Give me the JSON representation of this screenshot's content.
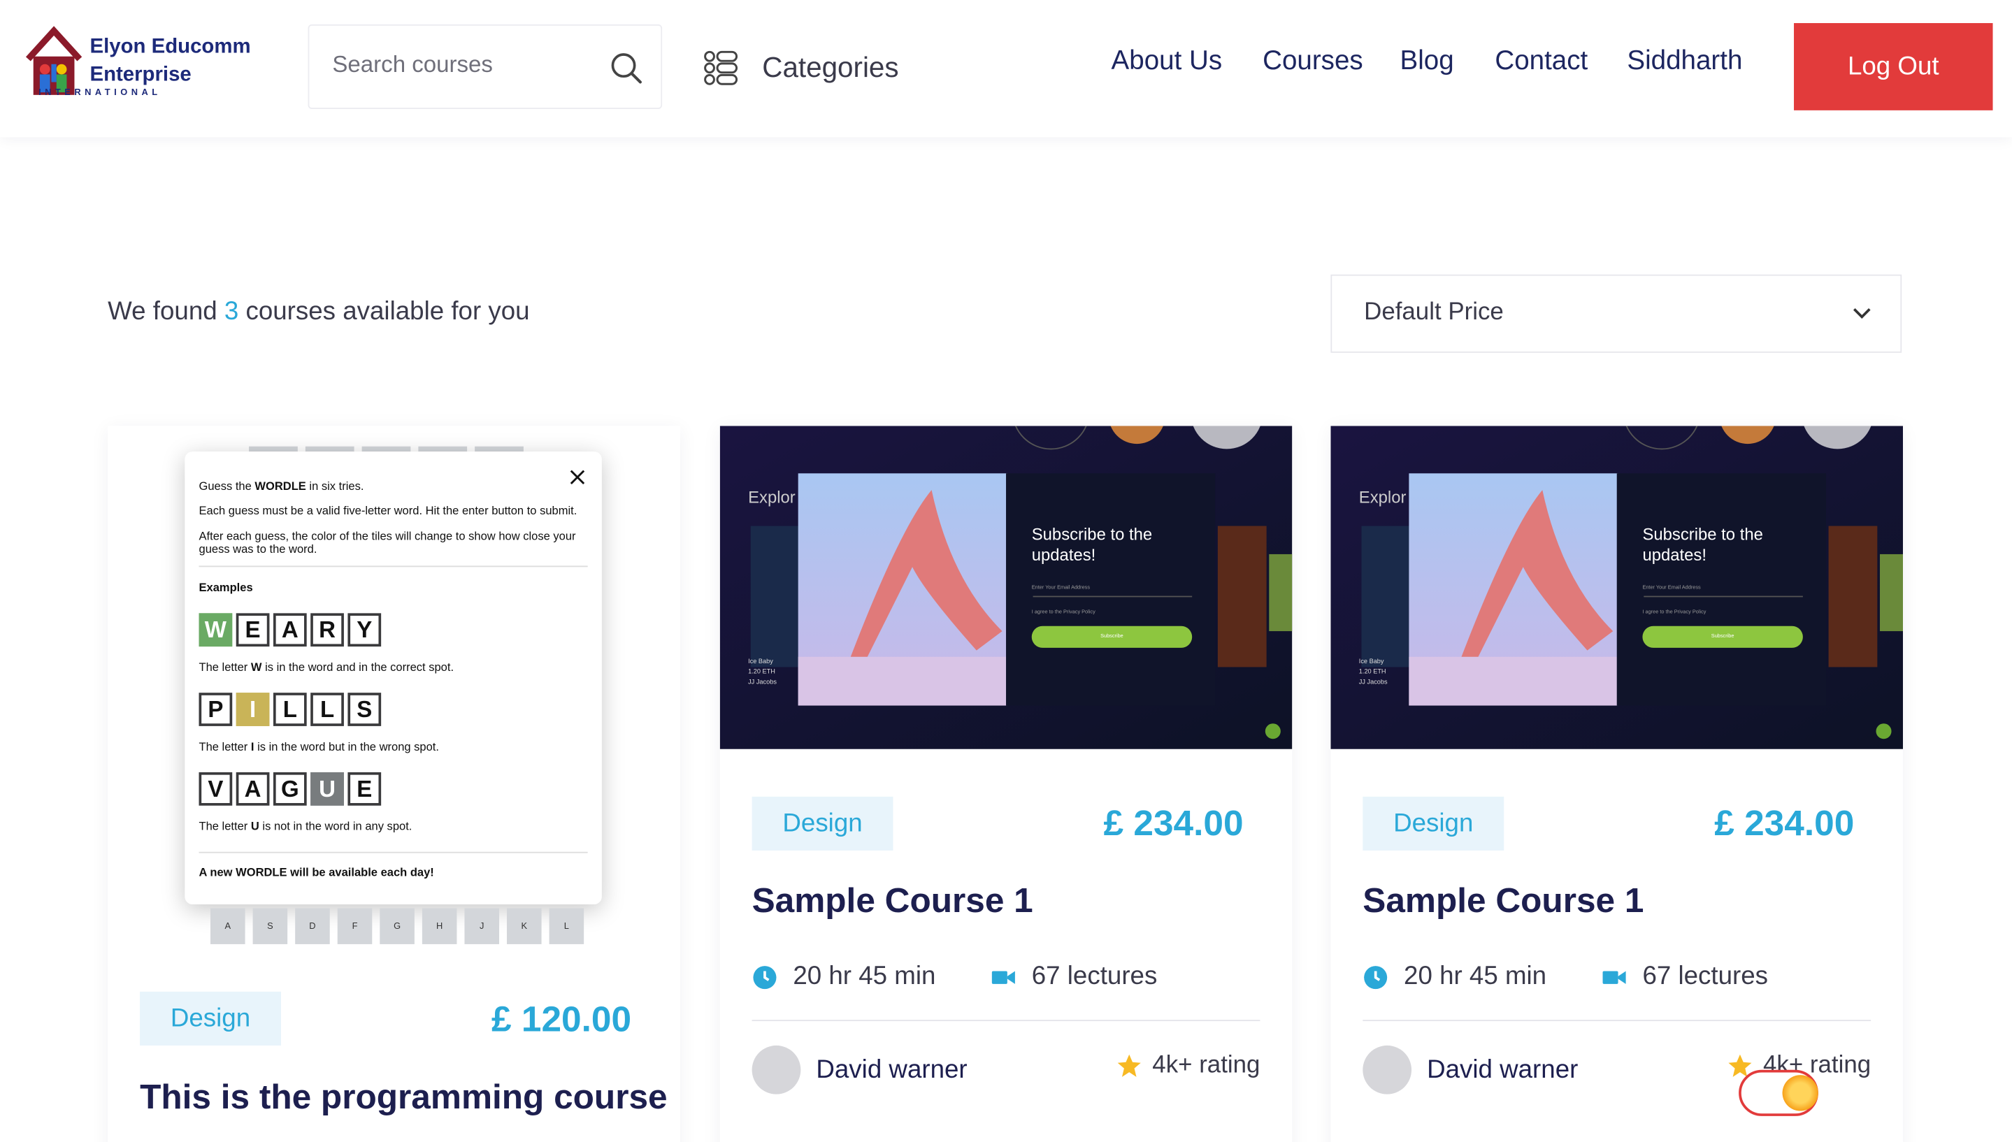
{
  "brand": {
    "line1": "Elyon Educomm",
    "line2": "Enterprise",
    "line3": "INTERNATIONAL"
  },
  "search": {
    "placeholder": "Search courses"
  },
  "categories_label": "Categories",
  "nav": [
    "About Us",
    "Courses",
    "Blog",
    "Contact",
    "Siddharth"
  ],
  "logout_label": "Log Out",
  "found": {
    "prefix": "We found",
    "count": "3",
    "suffix": "courses available for you"
  },
  "sort": {
    "selected": "Default Price"
  },
  "colors": {
    "accent": "#2aa8d8",
    "danger": "#e23b3b",
    "heading": "#1d1f4f"
  },
  "cards": [
    {
      "category": "Design",
      "price": "£ 120.00",
      "title": "This is the programming course",
      "thumb": {
        "type": "wordle",
        "intro_pre": "Guess the ",
        "intro_bold": "WORDLE",
        "intro_post": " in six tries.",
        "rule1": "Each guess must be a valid five-letter word. Hit the enter button to submit.",
        "rule2": "After each guess, the color of the tiles will change to show how close your guess was to the word.",
        "examples_label": "Examples",
        "ex1_letters": [
          "W",
          "E",
          "A",
          "R",
          "Y"
        ],
        "ex1_pre": "The letter ",
        "ex1_bold": "W",
        "ex1_post": " is in the word and in the correct spot.",
        "ex2_letters": [
          "P",
          "I",
          "L",
          "L",
          "S"
        ],
        "ex2_pre": "The letter ",
        "ex2_bold": "I",
        "ex2_post": " is in the word but in the wrong spot.",
        "ex3_letters": [
          "V",
          "A",
          "G",
          "U",
          "E"
        ],
        "ex3_pre": "The letter ",
        "ex3_bold": "U",
        "ex3_post": " is not in the word in any spot.",
        "footer": "A new WORDLE will be available each day!",
        "keys": [
          "A",
          "S",
          "D",
          "F",
          "G",
          "H",
          "J",
          "K",
          "L"
        ]
      }
    },
    {
      "category": "Design",
      "price": "£ 234.00",
      "title": "Sample Course 1",
      "duration": "20 hr 45 min",
      "lectures": "67 lectures",
      "author": "David warner",
      "rating": "4k+ rating",
      "thumb": {
        "type": "subscribe",
        "heading": "Subscribe to the updates!",
        "explore": "Explor",
        "email_placeholder": "Enter Your Email Address",
        "agree": "I agree to the Privacy Policy",
        "button": "Subscribe",
        "item_name": "Ice Baby",
        "item_price": "1.20 ETH",
        "item_author": "JJ Jacobs"
      }
    },
    {
      "category": "Design",
      "price": "£ 234.00",
      "title": "Sample Course 1",
      "duration": "20 hr 45 min",
      "lectures": "67 lectures",
      "author": "David warner",
      "rating": "4k+ rating",
      "thumb": {
        "type": "subscribe",
        "heading": "Subscribe to the updates!",
        "explore": "Explor",
        "email_placeholder": "Enter Your Email Address",
        "agree": "I agree to the Privacy Policy",
        "button": "Subscribe",
        "item_name": "Ice Baby",
        "item_price": "1.20 ETH",
        "item_author": "JJ Jacobs"
      }
    }
  ]
}
